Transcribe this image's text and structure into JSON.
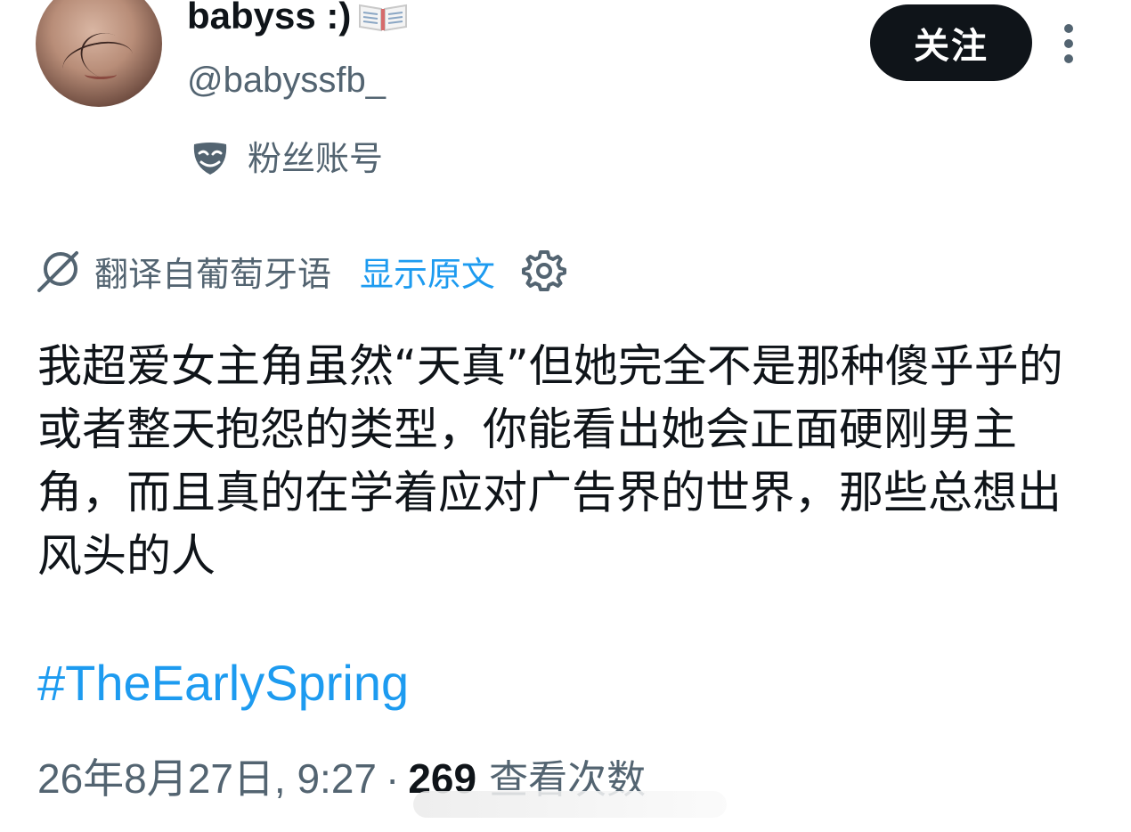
{
  "user": {
    "display_name": "babyss :)",
    "display_icon": "open-book-icon",
    "handle": "@babyssfb_",
    "account_badge_icon": "mask-icon",
    "account_badge_label": "粉丝账号"
  },
  "actions": {
    "follow_label": "关注",
    "more_icon": "vertical-ellipsis-icon"
  },
  "translation": {
    "icon": "translate-icon",
    "source_label": "翻译自葡萄牙语",
    "show_original_label": "显示原文",
    "settings_icon": "gear-icon"
  },
  "post": {
    "text": "我超爱女主角虽然“天真”但她完全不是那种傻乎乎的或者整天抱怨的类型，你能看出她会正面硬刚男主角，而且真的在学着应对广告界的世界，那些总想出风头的人",
    "hashtag": "#TheEarlySpring"
  },
  "meta": {
    "timestamp": "26年8月27日, 9:27",
    "separator": "·",
    "views_count": "269",
    "views_label": "查看次数"
  },
  "colors": {
    "link": "#1d9bf0",
    "secondary_text": "#536471",
    "primary_text": "#0f1419",
    "button_bg": "#0f1419"
  }
}
